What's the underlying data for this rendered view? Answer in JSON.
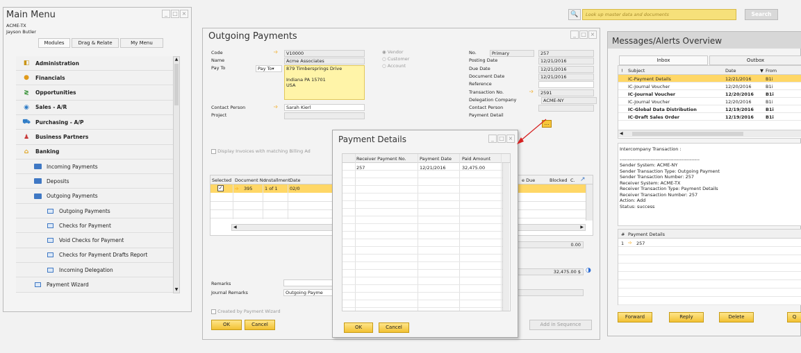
{
  "search": {
    "placeholder": "Look up master data and documents",
    "button": "Search"
  },
  "main_menu": {
    "title": "Main Menu",
    "company": "ACME-TX",
    "user": "Jayson Butler",
    "tabs": [
      "Modules",
      "Drag & Relate",
      "My Menu"
    ],
    "items": [
      {
        "label": "Administration",
        "icon": "administration-icon",
        "bold": true
      },
      {
        "label": "Financials",
        "icon": "financials-icon",
        "bold": true
      },
      {
        "label": "Opportunities",
        "icon": "opportunities-icon",
        "bold": true
      },
      {
        "label": "Sales - A/R",
        "icon": "sales-icon",
        "bold": true
      },
      {
        "label": "Purchasing - A/P",
        "icon": "purchasing-icon",
        "bold": true
      },
      {
        "label": "Business Partners",
        "icon": "business-partners-icon",
        "bold": true
      },
      {
        "label": "Banking",
        "icon": "banking-icon",
        "bold": true
      },
      {
        "label": "Incoming Payments",
        "icon": "folder-icon",
        "bold": false
      },
      {
        "label": "Deposits",
        "icon": "folder-icon",
        "bold": false
      },
      {
        "label": "Outgoing Payments",
        "icon": "folder-open-icon",
        "bold": false
      },
      {
        "label": "Outgoing Payments",
        "icon": "document-icon",
        "bold": false
      },
      {
        "label": "Checks for Payment",
        "icon": "document-icon",
        "bold": false
      },
      {
        "label": "Void Checks for Payment",
        "icon": "document-icon",
        "bold": false
      },
      {
        "label": "Checks for Payment Drafts Report",
        "icon": "document-icon",
        "bold": false
      },
      {
        "label": "Incoming Delegation",
        "icon": "document-icon",
        "bold": false
      },
      {
        "label": "Payment Wizard",
        "icon": "document-icon",
        "bold": false
      }
    ]
  },
  "outgoing": {
    "title": "Outgoing Payments",
    "code_label": "Code",
    "code": "V10000",
    "name_label": "Name",
    "name": "Acme Associates",
    "payto_label": "Pay To",
    "payto_select": "Pay To",
    "address": [
      "879 Timbersprings Drive",
      "",
      "Indiana PA  15701",
      "USA"
    ],
    "contact_label": "Contact Person",
    "contact": "Sarah Kierl",
    "project_label": "Project",
    "radios": [
      "Vendor",
      "Customer",
      "Account"
    ],
    "right": [
      {
        "label": "No.",
        "value": "Primary",
        "value2": "257"
      },
      {
        "label": "Posting Date",
        "value": "12/21/2016"
      },
      {
        "label": "Due Date",
        "value": "12/21/2016"
      },
      {
        "label": "Document Date",
        "value": "12/21/2016"
      },
      {
        "label": "Reference",
        "value": ""
      },
      {
        "label": "Transaction No.",
        "value": "2591"
      },
      {
        "label": "Delegation Company",
        "value": "ACME-NY"
      },
      {
        "label": "Contact Person",
        "value": ""
      },
      {
        "label": "Payment Detail",
        "value": ""
      }
    ],
    "display_invoices": "Display Invoices with matching Billing Ad",
    "columns": [
      "Selected",
      "Document No.",
      "Installment",
      "Date"
    ],
    "columns_right": [
      "e Due",
      "Blocked",
      "C."
    ],
    "row": {
      "doc": "395",
      "installment": "1 of 1",
      "date": "02/0"
    },
    "amount_zero": "0.00",
    "total": "32,475.00 $",
    "remarks_label": "Remarks",
    "journal_label": "Journal Remarks",
    "journal": "Outgoing Payme",
    "created_by_wizard": "Created by Payment Wizard",
    "ok": "OK",
    "cancel": "Cancel",
    "add_seq": "Add in Sequence"
  },
  "payment_details": {
    "title": "Payment Details",
    "columns": [
      "#",
      "Receiver Payment No.",
      "Payment Date",
      "Paid Amount"
    ],
    "row": {
      "no": "257",
      "date": "12/21/2016",
      "amount": "32,475.00"
    },
    "ok": "OK",
    "cancel": "Cancel"
  },
  "messages": {
    "title": "Messages/Alerts Overview",
    "tabs": [
      "Inbox",
      "Outbox"
    ],
    "columns": [
      "!",
      "Subject",
      "Date",
      "From"
    ],
    "rows": [
      {
        "subject": "IC-Payment Details",
        "date": "12/21/2016",
        "from": "B1i",
        "bold": false,
        "selected": true
      },
      {
        "subject": "IC-Journal Voucher",
        "date": "12/20/2016",
        "from": "B1i",
        "bold": false,
        "selected": false
      },
      {
        "subject": "IC-Journal Voucher",
        "date": "12/20/2016",
        "from": "B1i",
        "bold": true,
        "selected": false
      },
      {
        "subject": "IC-Journal Voucher",
        "date": "12/20/2016",
        "from": "B1i",
        "bold": false,
        "selected": false
      },
      {
        "subject": "IC-Global Data Distribution",
        "date": "12/19/2016",
        "from": "B1i",
        "bold": true,
        "selected": false
      },
      {
        "subject": "IC-Draft Sales Order",
        "date": "12/19/2016",
        "from": "B1i",
        "bold": true,
        "selected": false
      }
    ],
    "body": [
      "Intercompany Transaction :",
      "-------------------------------------------------",
      "Sender System: ACME-NY",
      "Sender Transaction Type: Outgoing Payment",
      "Sender Transaction Number: 257",
      "Receiver System: ACME-TX",
      "Receiver Transaction Type: Payment Details",
      "Receiver Transaction Number: 257",
      "Action: Add",
      "Status: success"
    ],
    "detail_header": "Payment Details",
    "detail_row": "257",
    "buttons": [
      "Forward",
      "Reply",
      "Delete",
      "Q"
    ]
  }
}
